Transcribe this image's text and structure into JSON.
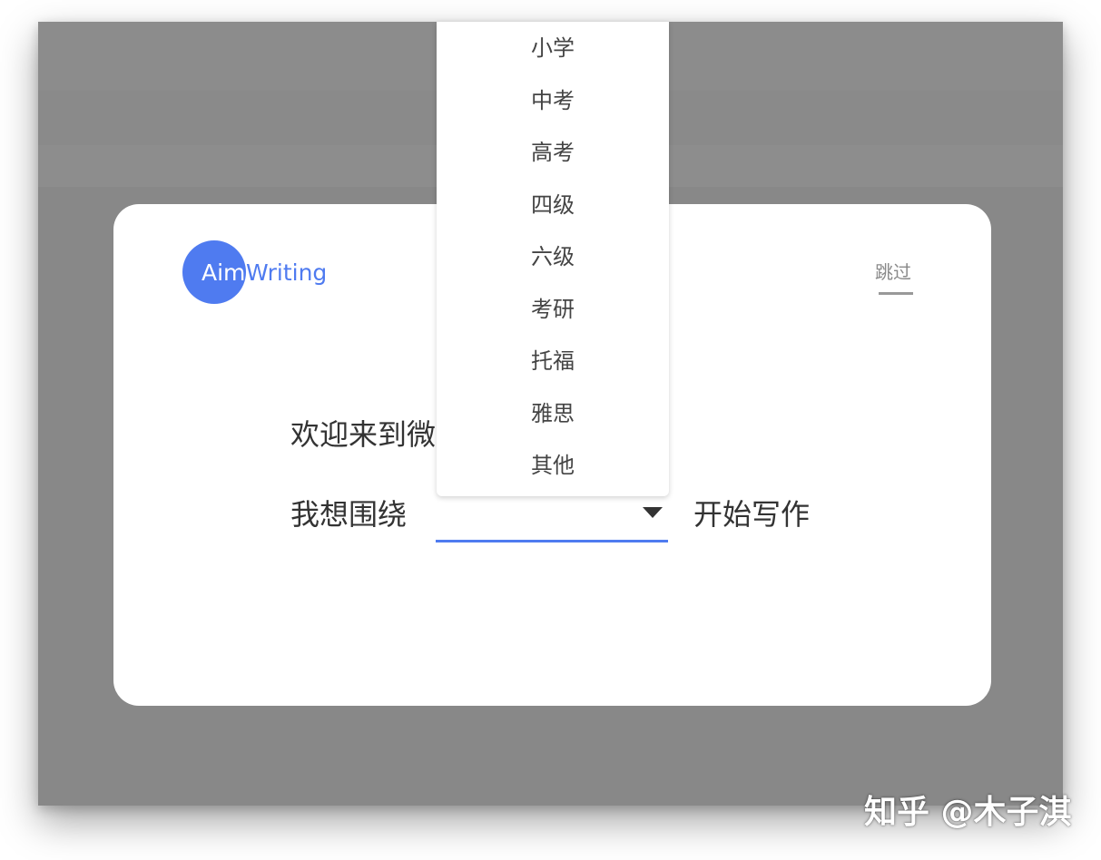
{
  "logo": {
    "part1": "Aim",
    "part2": "Writing",
    "color": "#4f7bf0"
  },
  "header": {
    "skip_label": "跳过"
  },
  "main": {
    "welcome_text": "欢迎来到微",
    "prefix_label": "我想围绕",
    "suffix_label": "开始写作",
    "select_value": ""
  },
  "dropdown": {
    "options": [
      "小学",
      "中考",
      "高考",
      "四级",
      "六级",
      "考研",
      "托福",
      "雅思",
      "其他"
    ]
  },
  "watermark": "知乎 @木子淇"
}
